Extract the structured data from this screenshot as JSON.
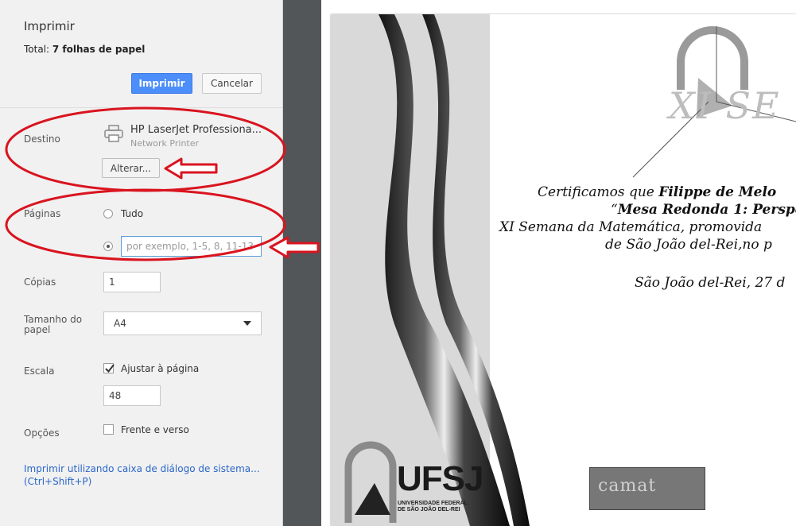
{
  "header": {
    "title": "Imprimir",
    "total_label": "Total: ",
    "total_value": "7 folhas de papel"
  },
  "actions": {
    "print": "Imprimir",
    "cancel": "Cancelar"
  },
  "destination": {
    "label": "Destino",
    "printer_name": "HP LaserJet Professiona...",
    "printer_type": "Network Printer",
    "change_button": "Alterar..."
  },
  "pages": {
    "label": "Páginas",
    "all_option": "Tudo",
    "custom_placeholder": "por exemplo, 1-5, 8, 11-13",
    "selected": "custom"
  },
  "copies": {
    "label": "Cópias",
    "value": "1"
  },
  "paper_size": {
    "label_line1": "Tamanho do",
    "label_line2": "papel",
    "value": "A4"
  },
  "scale": {
    "label": "Escala",
    "fit_label": "Ajustar à página",
    "fit_checked": true,
    "value": "48"
  },
  "options": {
    "label": "Opções",
    "duplex_label": "Frente e verso",
    "duplex_checked": false
  },
  "system_dialog": {
    "line1": "Imprimir utilizando caixa de diálogo de sistema...",
    "line2": "(Ctrl+Shift+P)"
  },
  "colors": {
    "accent": "#4c8efa",
    "annotation": "#d9141f",
    "preview_divider": "#525659"
  },
  "preview": {
    "logo_text": "XI SE",
    "line1_pre": "Certificamos que ",
    "line1_bold": "Filippe de Melo",
    "line2_pre": "“",
    "line2_bold": "Mesa Redonda 1: Perspe",
    "line3": "XI Semana da Matemática, promovida",
    "line4": "de São João del-Rei,no p",
    "line5": "São João del-Rei, 27 d",
    "ufsj": "UFSJ",
    "ufsj_sub1": "UNIVERSIDADE FEDERAL",
    "ufsj_sub2": "DE SÃO JOÃO DEL-REI",
    "camat": "camat"
  }
}
